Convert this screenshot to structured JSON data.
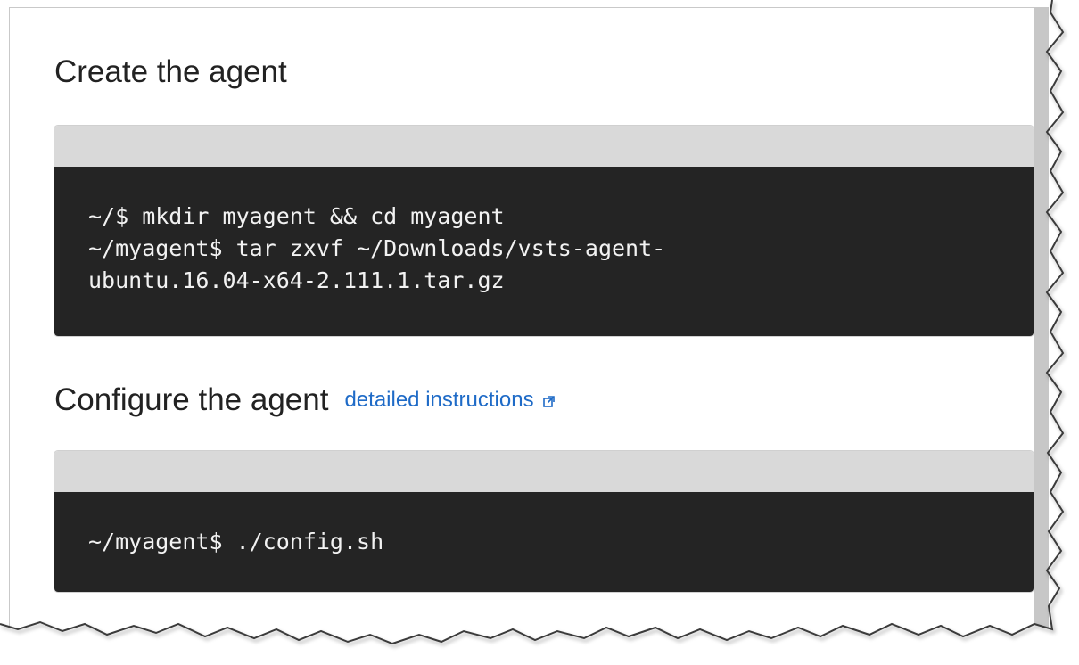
{
  "sections": [
    {
      "title": "Create the agent",
      "code_lines": [
        "~/$ mkdir myagent && cd myagent",
        "~/myagent$ tar zxvf ~/Downloads/vsts-agent-",
        "ubuntu.16.04-x64-2.111.1.tar.gz"
      ]
    },
    {
      "title": "Configure the agent",
      "link_label": "detailed instructions",
      "link_icon": "external-link-icon",
      "code_lines": [
        "~/myagent$ ./config.sh"
      ]
    }
  ],
  "colors": {
    "link": "#1f6bc7",
    "code_background": "#242424",
    "code_header": "#d9d9d9",
    "code_text": "#f2f2f2",
    "scrollbar": "#c7c7c7"
  }
}
